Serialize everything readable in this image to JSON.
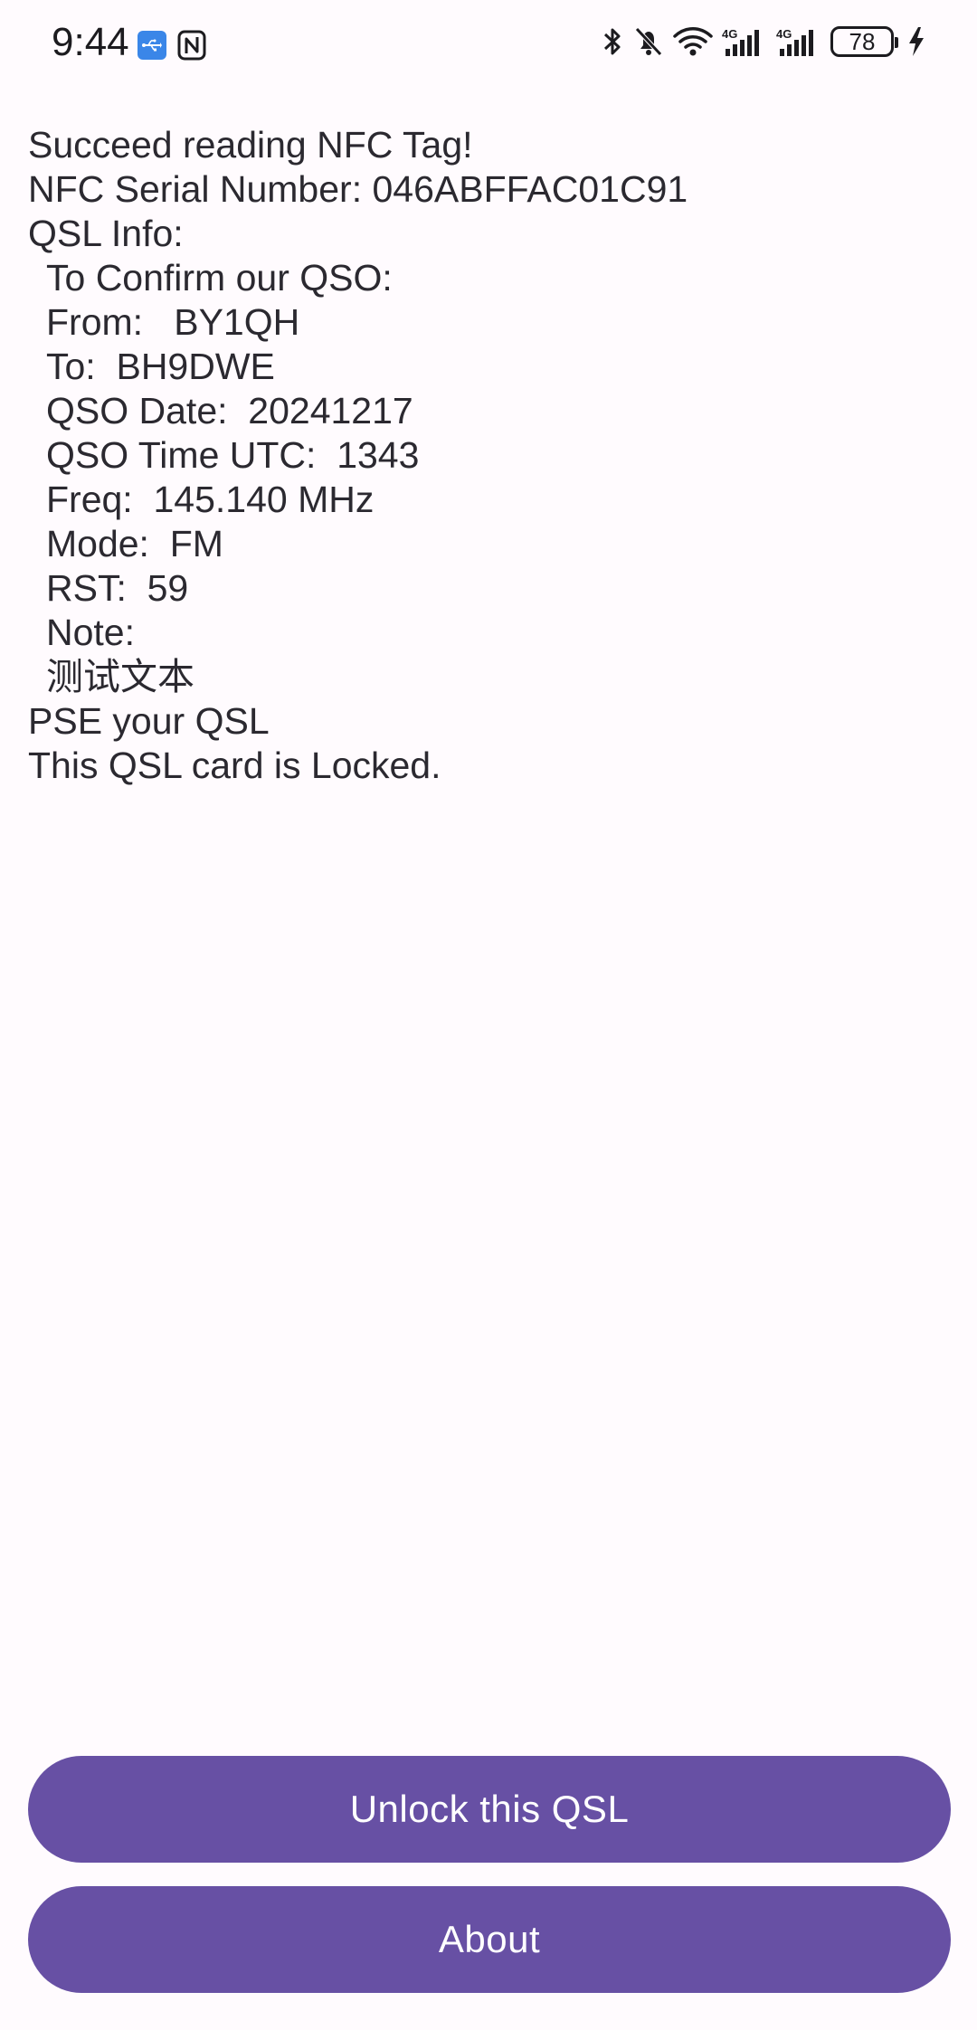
{
  "status_bar": {
    "time": "9:44",
    "battery_level": "78",
    "network_1": "4G",
    "network_2": "4G",
    "icons": [
      "usb-icon",
      "nfc-icon",
      "bluetooth-icon",
      "bell-off-icon",
      "wifi-icon",
      "signal-icon",
      "signal-icon",
      "battery-icon",
      "charging-icon"
    ]
  },
  "nfc_result": {
    "status": "Succeed reading NFC Tag!",
    "serial": "NFC Serial Number: 046ABFFAC01C91",
    "qsl_info_heading": "QSL Info:",
    "confirm": "To Confirm our QSO:",
    "from": "From:   BY1QH",
    "to": "To:  BH9DWE",
    "qso_date": "QSO Date:  20241217",
    "qso_time": "QSO Time UTC:  1343",
    "freq": "Freq:  145.140 MHz",
    "mode": "Mode:  FM",
    "rst": "RST:  59",
    "note_label": "Note:",
    "note_text": "测试文本",
    "pse": "PSE your QSL",
    "lock_status": "This QSL card is Locked."
  },
  "actions": {
    "unlock_label": "Unlock this QSL",
    "about_label": "About"
  },
  "colors": {
    "background": "#fffbfe",
    "button": "#6750a4",
    "button_text": "#ffffff",
    "text": "#2b2930"
  }
}
